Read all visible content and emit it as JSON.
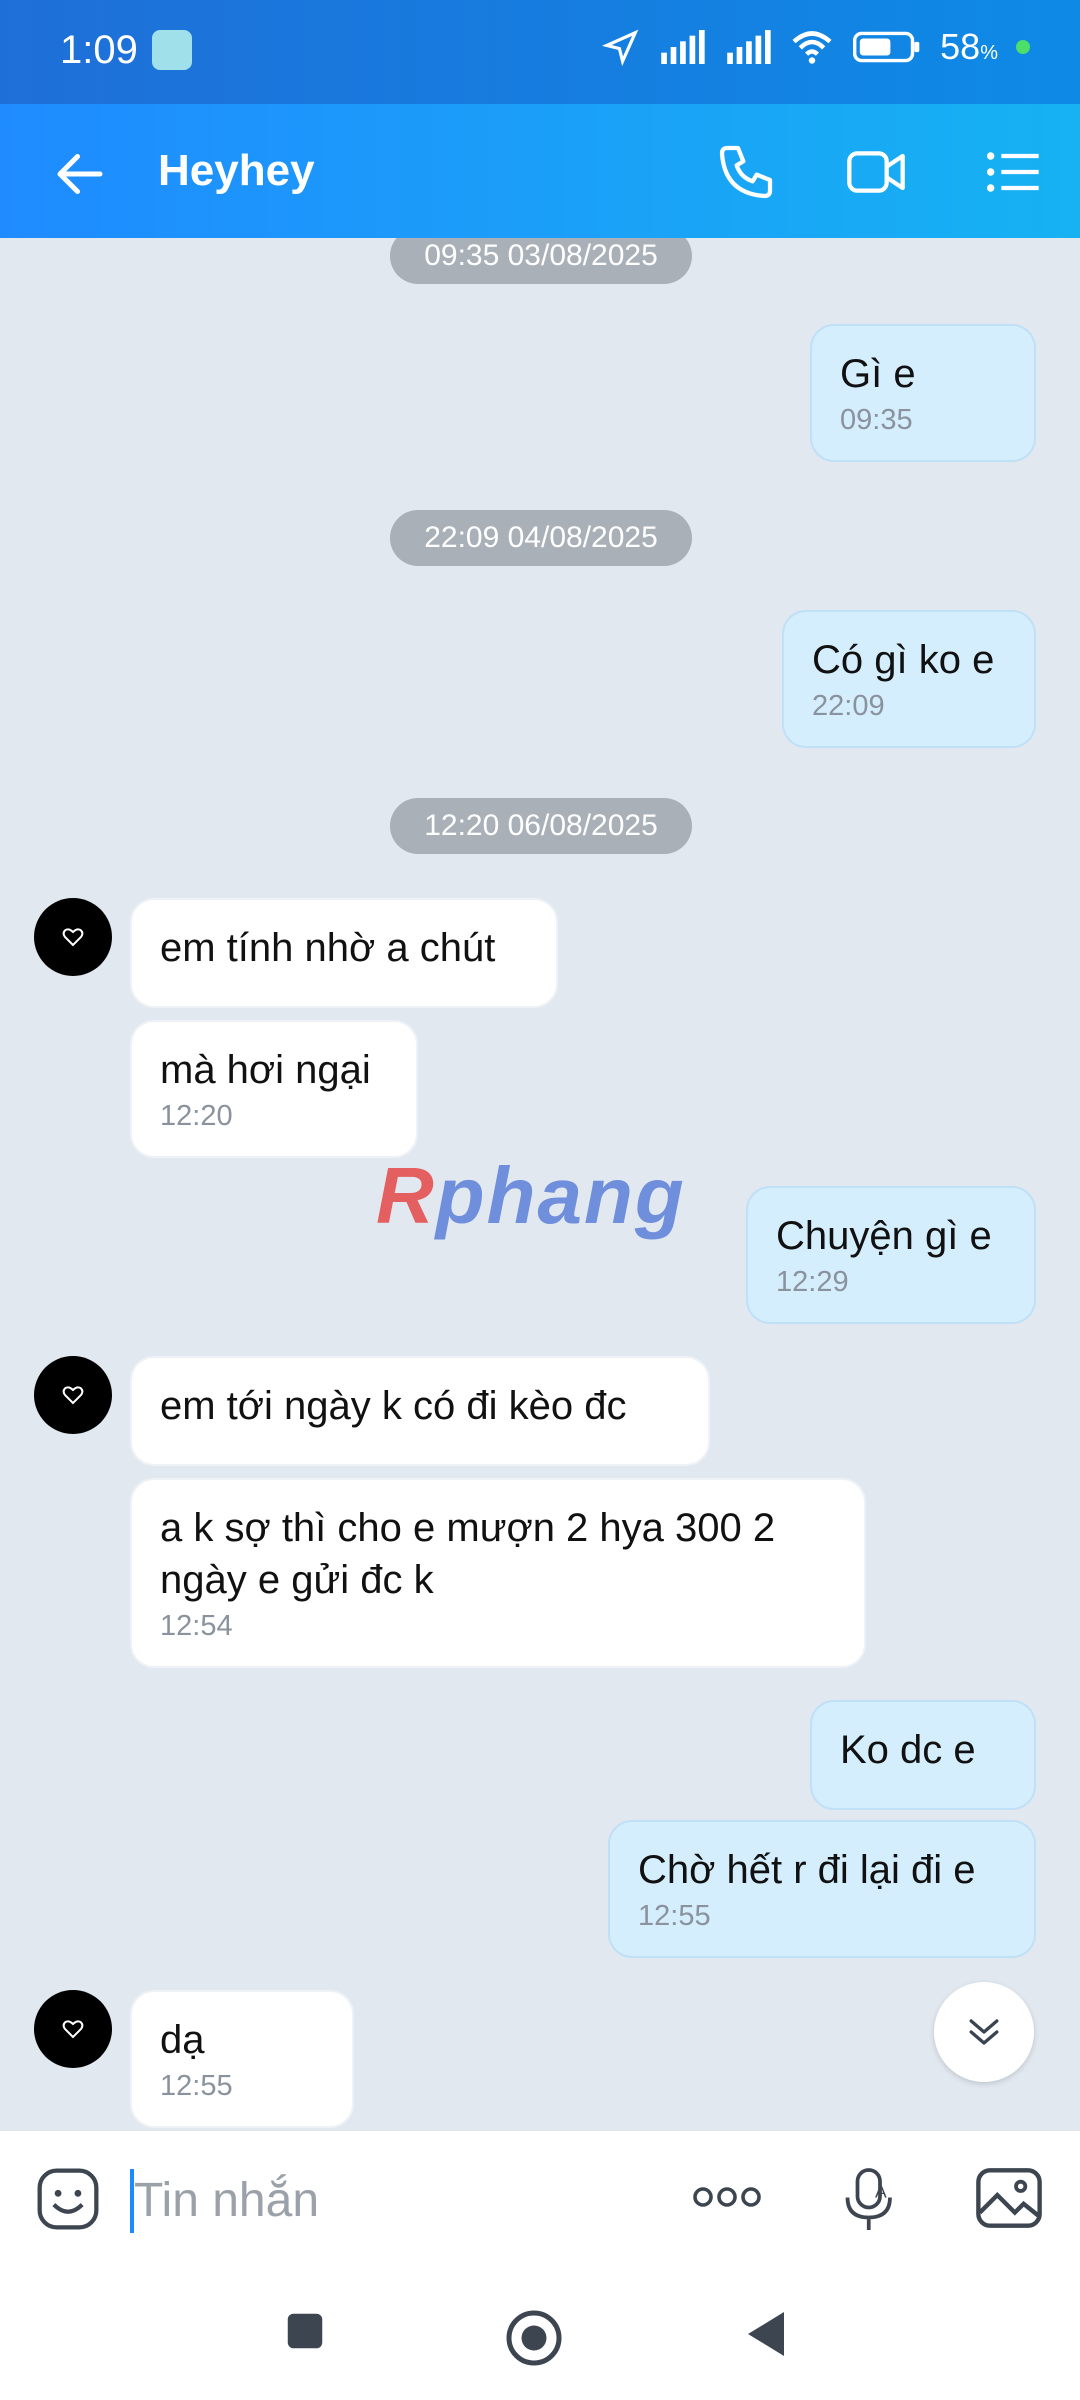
{
  "status_bar": {
    "time": "1:09",
    "battery": "58",
    "battery_unit": "%"
  },
  "header": {
    "title": "Heyhey"
  },
  "messages": [
    {
      "type": "date",
      "text": "09:35 03/08/2025"
    },
    {
      "type": "out",
      "text": "Gì e",
      "time": "09:35"
    },
    {
      "type": "date",
      "text": "22:09 04/08/2025"
    },
    {
      "type": "out",
      "text": "Có gì ko e",
      "time": "22:09"
    },
    {
      "type": "date",
      "text": "12:20 06/08/2025"
    },
    {
      "type": "in",
      "text": "em tính nhờ a chút"
    },
    {
      "type": "in",
      "text": "mà hơi ngại",
      "time": "12:20"
    },
    {
      "type": "out",
      "text": "Chuyện gì e",
      "time": "12:29"
    },
    {
      "type": "in",
      "text": "em tới ngày k có đi kèo đc"
    },
    {
      "type": "in",
      "text": "a k sợ thì cho e mượn 2 hya 300 2\nngày e gửi đc k",
      "time": "12:54"
    },
    {
      "type": "out",
      "text": "Ko dc e"
    },
    {
      "type": "out",
      "text": "Chờ hết r đi lại đi e",
      "time": "12:55"
    },
    {
      "type": "in",
      "text": "dạ",
      "time": "12:55"
    }
  ],
  "watermark": {
    "first": "R",
    "rest": "phang"
  },
  "input": {
    "placeholder": "Tin nhắn"
  }
}
